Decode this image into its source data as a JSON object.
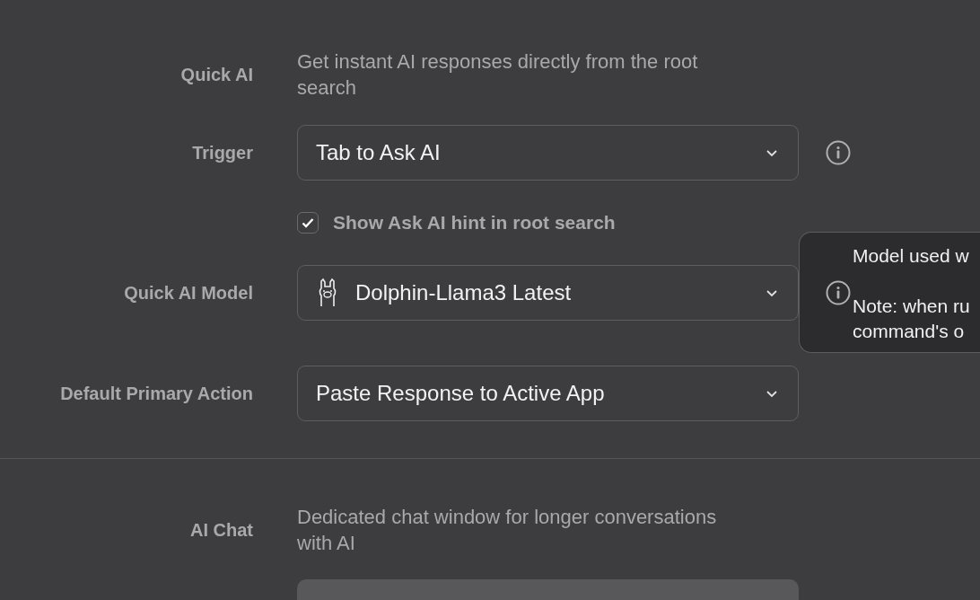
{
  "rows": [
    {
      "kind": "description",
      "label": "Quick AI",
      "text": "Get instant AI responses directly from the root search"
    },
    {
      "kind": "dropdown",
      "label": "Trigger",
      "value": "Tab to Ask AI",
      "info": true
    },
    {
      "kind": "checkbox",
      "text": "Show Ask AI hint in root search",
      "checked": true
    },
    {
      "kind": "model-dropdown",
      "label": "Quick AI Model",
      "value": "Dolphin-Llama3 Latest",
      "info": true
    },
    {
      "kind": "dropdown",
      "label": "Default Primary Action",
      "value": "Paste Response to Active App",
      "info": false
    },
    {
      "kind": "divider"
    },
    {
      "kind": "description",
      "label": "AI Chat",
      "text": "Dedicated chat window for longer conversations with AI"
    },
    {
      "kind": "button"
    }
  ],
  "tooltip": {
    "lines": [
      "Model used w",
      "Note: when ru",
      "command's o"
    ]
  }
}
